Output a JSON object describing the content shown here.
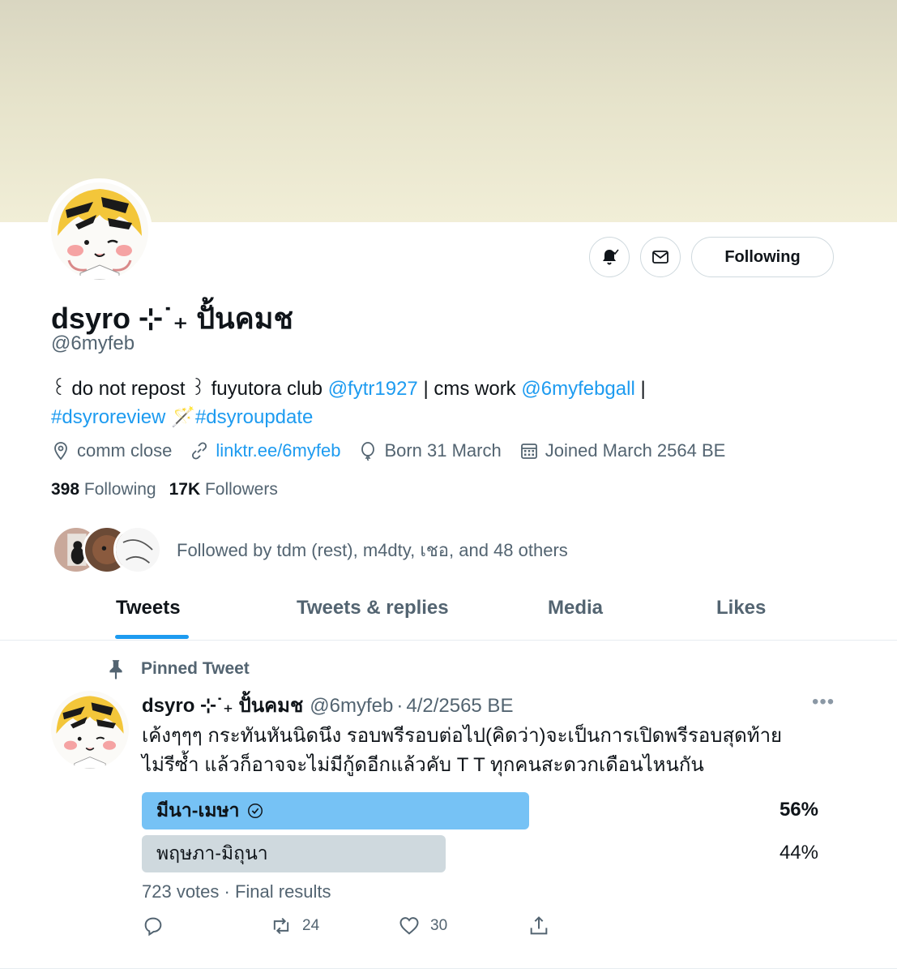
{
  "profile": {
    "display_name": "dsyro ⊹˙₊ ปั้นคมช",
    "handle": "@6myfeb",
    "follow_button": "Following",
    "bio": {
      "text1": "꒰ do not repost ꒱ fuyutora club ",
      "mention1": "@fytr1927",
      "text2": " | cms work ",
      "mention2": "@6myfebgall",
      "text3": " |",
      "hashtag1": "#dsyroreview",
      "emoji": " 🪄",
      "hashtag2": "#dsyroupdate"
    },
    "location": "comm close",
    "url": "linktr.ee/6myfeb",
    "birthday": "Born 31 March",
    "joined": "Joined March 2564 BE",
    "following_count": "398",
    "following_label": "Following",
    "followers_count": "17K",
    "followers_label": "Followers",
    "followed_by": "Followed by tdm (rest), m4dty, เชอ, and 48 others"
  },
  "tabs": [
    "Tweets",
    "Tweets & replies",
    "Media",
    "Likes"
  ],
  "tweet": {
    "pinned_label": "Pinned Tweet",
    "name": "dsyro ⊹˙₊ ปั้นคมช",
    "handle": "@6myfeb",
    "date": "4/2/2565 BE",
    "separator": "·",
    "more": "•••",
    "text_line1": "เค้งๆๆๆ กระทันหันนิดนึง รอบพรีรอบต่อไป(คิดว่า)จะเป็นการเปิดพรีรอบสุดท้าย",
    "text_line2": "ไม่รีซ้ำ แล้วก็อาจจะไม่มีกู้ดอีกแล้วคับ T  T ทุกคนสะดวกเดือนไหนกัน",
    "poll": {
      "options": [
        {
          "label": "มีนา-เมษา",
          "percent": "56%",
          "value": 56,
          "winner": true
        },
        {
          "label": "พฤษภา-มิถุนา",
          "percent": "44%",
          "value": 44,
          "winner": false
        }
      ],
      "summary": "723 votes · Final results"
    },
    "retweets": "24",
    "likes": "30"
  },
  "colors": {
    "accent": "#1d9bf0",
    "poll_winner": "#76c2f5",
    "poll_loser": "#cfd9de",
    "muted_text": "#536471"
  }
}
